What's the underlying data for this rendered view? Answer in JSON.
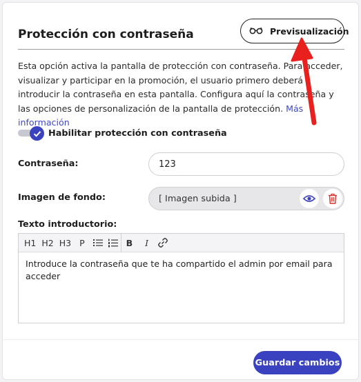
{
  "header": {
    "title": "Protección con contraseña",
    "preview_label": "Previsualización"
  },
  "description": {
    "text": "Esta opción activa la pantalla de protección con contraseña. Para acceder, visualizar y participar en la promoción, el usuario primero deberá introducir la contraseña en esta pantalla. Configura aquí la contraseña y las opciones de personalización de la pantalla de protección.",
    "link": "Más información"
  },
  "toggle": {
    "label": "Habilitar protección con contraseña",
    "checked": true
  },
  "password": {
    "label": "Contraseña:",
    "value": "123"
  },
  "background_image": {
    "label": "Imagen de fondo:",
    "value": "[ Imagen subida ]"
  },
  "intro_text": {
    "label": "Texto introductorio:",
    "toolbar": [
      "H1",
      "H2",
      "H3",
      "P",
      "B",
      "I"
    ],
    "content": "Introduce la contraseña que te ha compartido el admin por email para acceder"
  },
  "footer": {
    "save_label": "Guardar cambios"
  },
  "colors": {
    "accent": "#3a42c0",
    "annotation_arrow": "#e8201e",
    "delete": "#d9302c"
  }
}
